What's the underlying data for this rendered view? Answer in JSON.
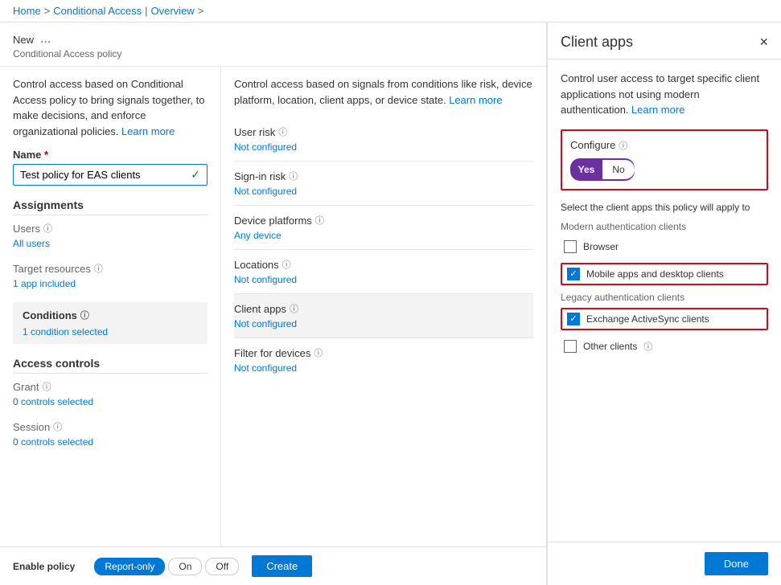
{
  "breadcrumb": {
    "home": "Home",
    "sep1": ">",
    "conditional_access": "Conditional Access",
    "sep2": "|",
    "overview": "Overview",
    "sep3": ">"
  },
  "page": {
    "title": "New",
    "ellipsis": "...",
    "subtitle": "Conditional Access policy"
  },
  "left_desc": "Control access based on Conditional Access policy to bring signals together, to make decisions, and enforce organizational policies.",
  "left_learn_more": "Learn more",
  "right_desc": "Control access based on signals from conditions like risk, device platform, location, client apps, or device state.",
  "right_learn_more": "Learn more",
  "name_field": {
    "label": "Name",
    "required": "*",
    "value": "Test policy for EAS clients",
    "check": "✓"
  },
  "assignments": {
    "title": "Assignments",
    "users_label": "Users",
    "users_value": "All users",
    "target_resources_label": "Target resources",
    "target_resources_value": "1 app included"
  },
  "conditions": {
    "title": "Conditions",
    "value": "1 condition selected"
  },
  "access_controls": {
    "title": "Access controls",
    "grant_label": "Grant",
    "grant_value": "0 controls selected",
    "session_label": "Session",
    "session_value": "0 controls selected"
  },
  "enable_policy": {
    "label": "Enable policy",
    "options": [
      "Report-only",
      "On",
      "Off"
    ],
    "active": "Report-only"
  },
  "create_button": "Create",
  "conditions_col": {
    "user_risk": {
      "label": "User risk",
      "value": "Not configured"
    },
    "sign_in_risk": {
      "label": "Sign-in risk",
      "value": "Not configured"
    },
    "device_platforms": {
      "label": "Device platforms",
      "value": "Any device"
    },
    "locations": {
      "label": "Locations",
      "value": "Not configured"
    },
    "client_apps": {
      "label": "Client apps",
      "value": "Not configured"
    },
    "filter_for_devices": {
      "label": "Filter for devices",
      "value": "Not configured"
    }
  },
  "client_apps_panel": {
    "title": "Client apps",
    "close": "×",
    "desc": "Control user access to target specific client applications not using modern authentication.",
    "learn_more": "Learn more",
    "configure_label": "Configure",
    "info": "ℹ",
    "yes": "Yes",
    "no": "No",
    "select_label": "Select the client apps this policy will apply to",
    "modern_auth_label": "Modern authentication clients",
    "browser_label": "Browser",
    "mobile_label": "Mobile apps and desktop clients",
    "legacy_auth_label": "Legacy authentication clients",
    "exchange_label": "Exchange ActiveSync clients",
    "other_label": "Other clients",
    "other_info": "ℹ",
    "done_button": "Done"
  }
}
